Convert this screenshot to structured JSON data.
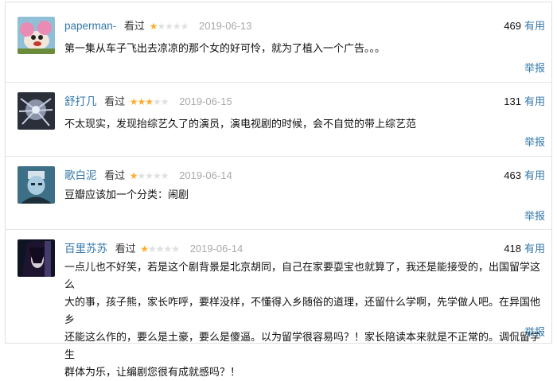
{
  "colors": {
    "link": "#3377aa",
    "star": "#ffac2d",
    "date": "#aaaaaa"
  },
  "reviews": [
    {
      "user": "paperman-",
      "status": "看过",
      "rating": 1,
      "date": "2019-06-13",
      "votes": "469",
      "useful_label": "有用",
      "text": "第一集从车子飞出去凉凉的那个女的好可怜，就为了植入一个广告。。。",
      "report_label": "举报"
    },
    {
      "user": "舒打几",
      "status": "看过",
      "rating": 3,
      "date": "2019-06-15",
      "votes": "131",
      "useful_label": "有用",
      "text": "不太现实，发现抬综艺久了的演员，演电视剧的时候，会不自觉的带上综艺范",
      "report_label": "举报"
    },
    {
      "user": "歌白泥",
      "status": "看过",
      "rating": 1,
      "date": "2019-06-14",
      "votes": "463",
      "useful_label": "有用",
      "text": "豆瓣应该加一个分类：闹剧",
      "report_label": "举报"
    },
    {
      "user": "百里苏苏",
      "status": "看过",
      "rating": 1,
      "date": "2019-06-14",
      "votes": "418",
      "useful_label": "有用",
      "text_lines": [
        "一点儿也不好笑，若是这个剧背景是北京胡同，自己在家要耍宝也就算了，我还是能接受的，出国留学这么",
        "大的事，孩子熊，家长咋呼，要样没样，不懂得入乡随俗的道理，还留什么学啊，先学做人吧。在异国他乡",
        "还能这么作的，要么是土豪，要么是傻逼。以为留学很容易吗？！家长陪读本来就是不正常的。调侃留学生",
        "群体为乐，让编剧您很有成就感吗？！"
      ],
      "report_label": "举报"
    }
  ]
}
